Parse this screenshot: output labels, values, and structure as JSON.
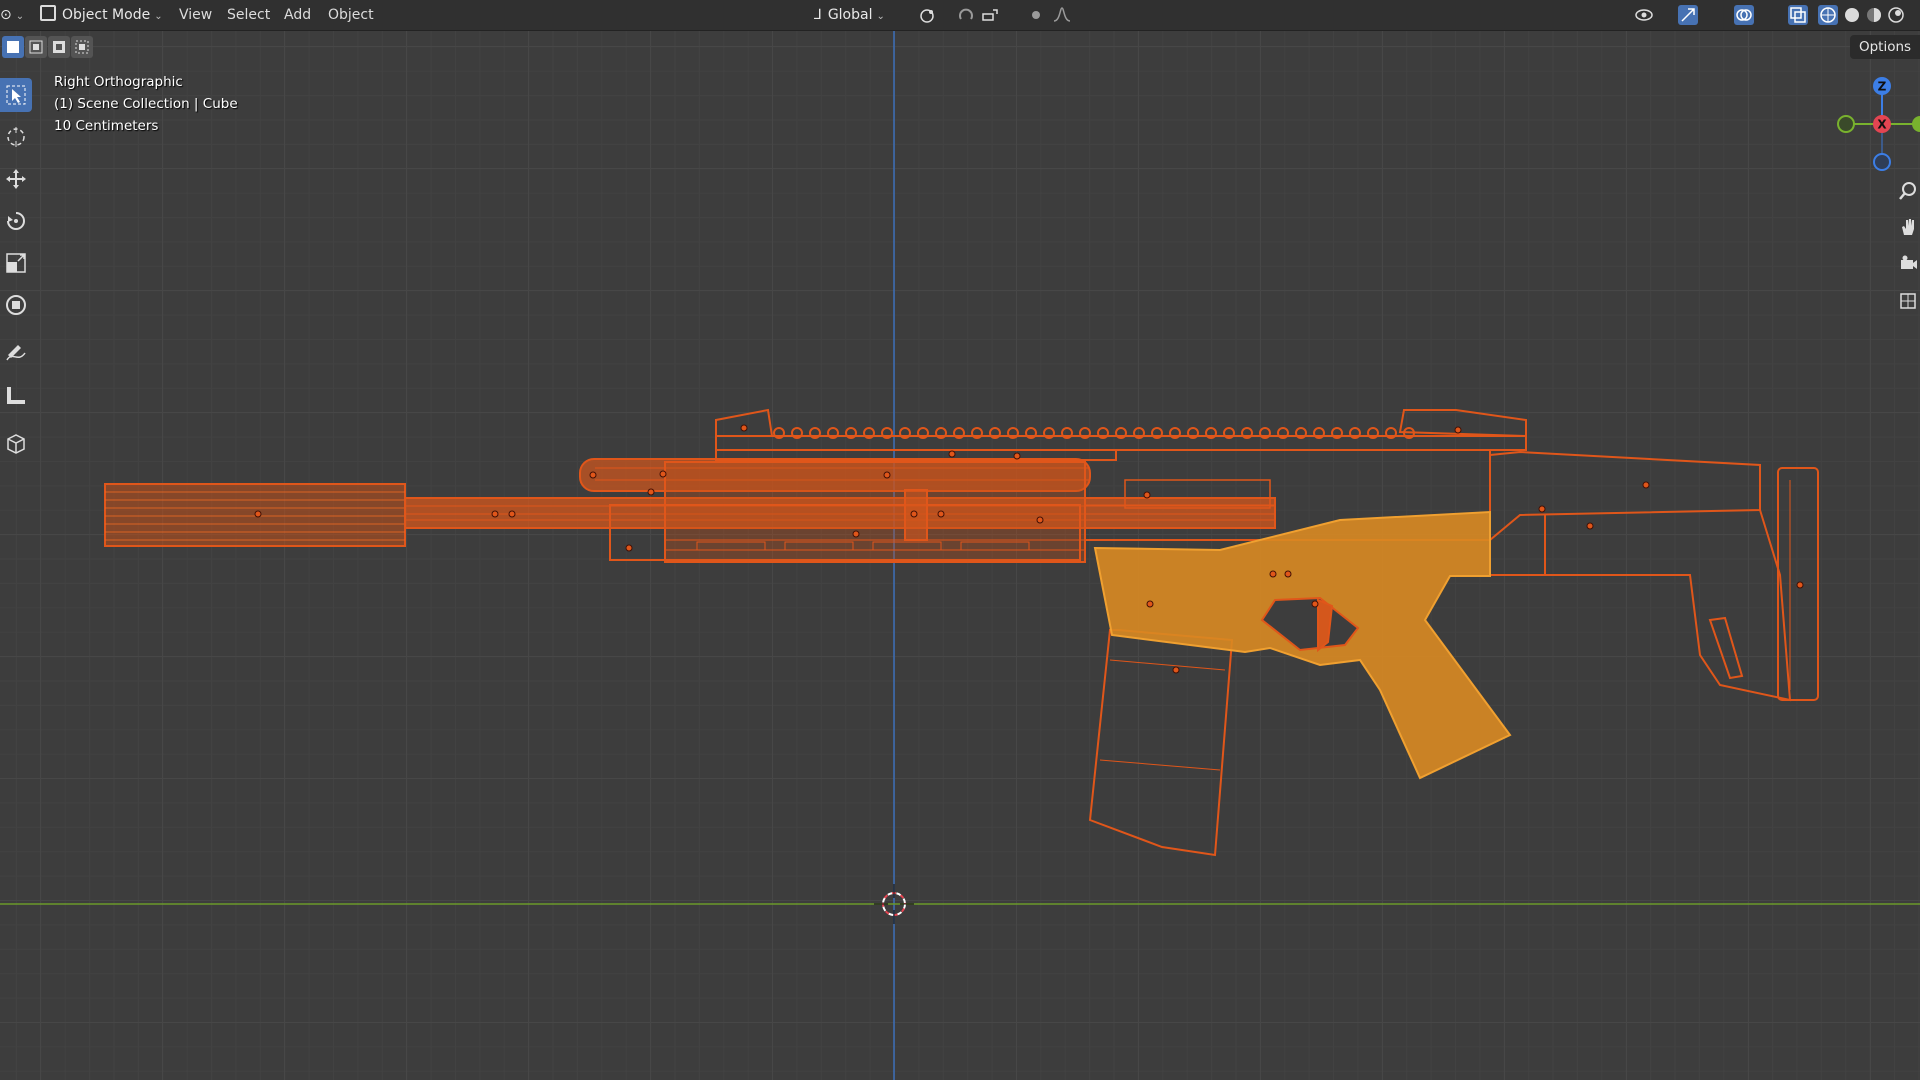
{
  "header": {
    "editor_type_icon": "cube-icon",
    "mode_label": "Object Mode",
    "menus": [
      "View",
      "Select",
      "Add",
      "Object"
    ],
    "transform_orientation": "Global",
    "options_label": "Options"
  },
  "viewport_overlay": {
    "view_name": "Right Orthographic",
    "collection_info": "(1) Scene Collection | Cube",
    "scale_info": "10 Centimeters"
  },
  "gizmo": {
    "z_label": "Z",
    "x_label": "X"
  },
  "toolbar": {
    "tools": [
      "select-box-icon",
      "cursor-icon",
      "move-icon",
      "rotate-icon",
      "scale-icon",
      "transform-icon",
      "annotate-icon",
      "measure-icon",
      "add-cube-icon"
    ],
    "active_tool": "select-box-icon"
  },
  "colors": {
    "selected_wire": "#e0561a",
    "active_object": "#d98a22",
    "x_axis": "#e44552",
    "y_axis": "#79b22e",
    "z_axis": "#3c7ee6",
    "accent": "#4772b3"
  }
}
